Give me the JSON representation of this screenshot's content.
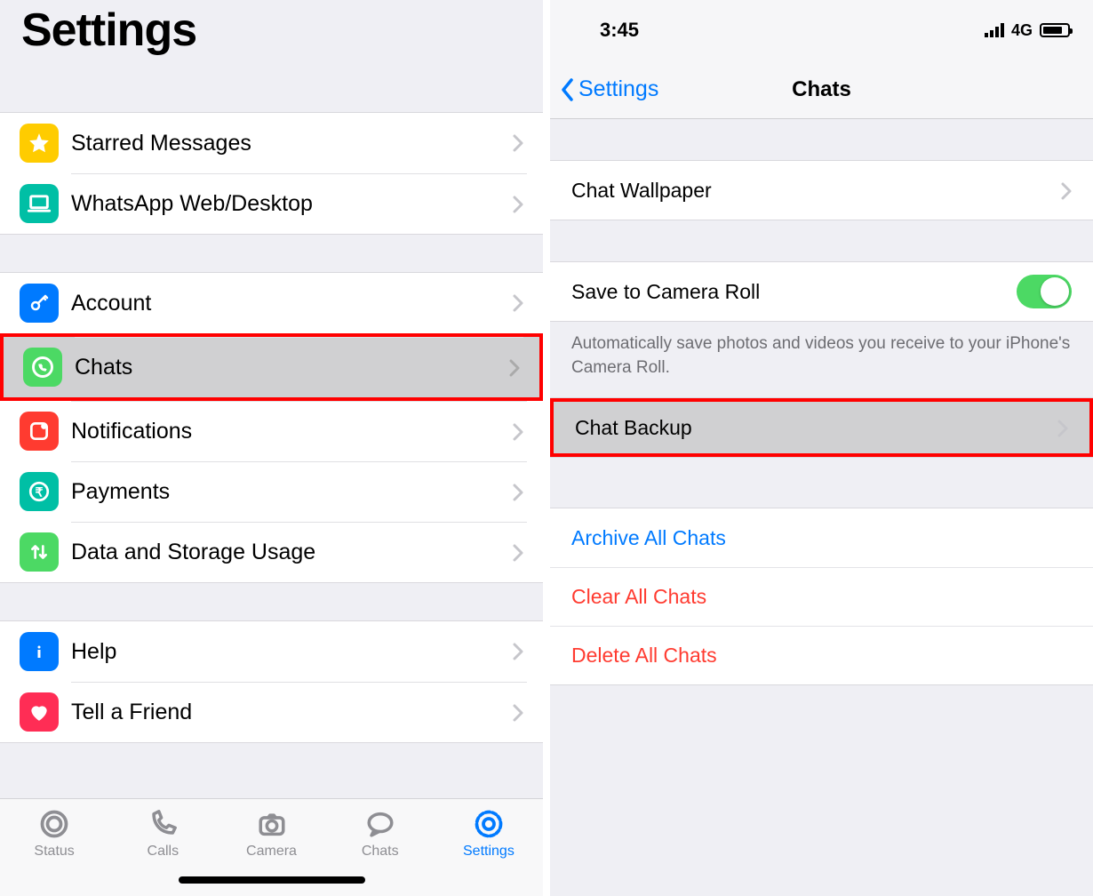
{
  "left": {
    "title": "Settings",
    "group1": [
      {
        "label": "Starred Messages",
        "icon": "star",
        "iconColor": "ic-yellow"
      },
      {
        "label": "WhatsApp Web/Desktop",
        "icon": "laptop",
        "iconColor": "ic-teal"
      }
    ],
    "group2": [
      {
        "label": "Account",
        "icon": "key",
        "iconColor": "ic-blue"
      },
      {
        "label": "Chats",
        "icon": "whatsapp",
        "iconColor": "ic-green",
        "selected": true,
        "highlight": true
      },
      {
        "label": "Notifications",
        "icon": "notif",
        "iconColor": "ic-red"
      },
      {
        "label": "Payments",
        "icon": "rupee",
        "iconColor": "ic-teal"
      },
      {
        "label": "Data and Storage Usage",
        "icon": "arrows",
        "iconColor": "ic-green"
      }
    ],
    "group3": [
      {
        "label": "Help",
        "icon": "info",
        "iconColor": "ic-blue"
      },
      {
        "label": "Tell a Friend",
        "icon": "heart",
        "iconColor": "ic-pink"
      }
    ],
    "tabs": [
      {
        "label": "Status",
        "icon": "status"
      },
      {
        "label": "Calls",
        "icon": "calls"
      },
      {
        "label": "Camera",
        "icon": "camera"
      },
      {
        "label": "Chats",
        "icon": "chats"
      },
      {
        "label": "Settings",
        "icon": "gear",
        "active": true
      }
    ]
  },
  "right": {
    "status": {
      "time": "3:45",
      "net": "4G"
    },
    "nav": {
      "back": "Settings",
      "title": "Chats"
    },
    "wallpaper": "Chat Wallpaper",
    "camera_roll_label": "Save to Camera Roll",
    "camera_roll_on": true,
    "camera_roll_desc": "Automatically save photos and videos you receive to your iPhone's Camera Roll.",
    "backup": {
      "label": "Chat Backup",
      "highlight": true
    },
    "actions": {
      "archive": "Archive All Chats",
      "clear": "Clear All Chats",
      "delete": "Delete All Chats"
    }
  }
}
